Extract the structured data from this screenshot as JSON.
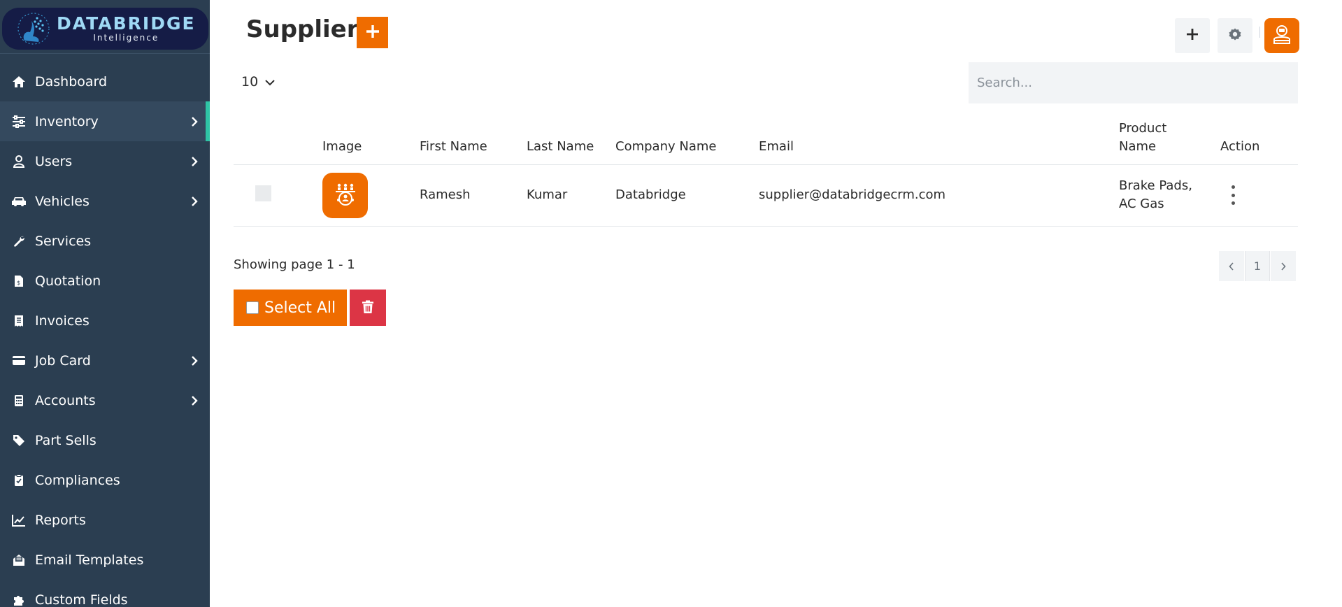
{
  "brand": {
    "name": "DATABRIDGE",
    "tagline": "Intelligence"
  },
  "sidebar": {
    "items": [
      {
        "label": "Dashboard",
        "icon": "home-icon",
        "has_submenu": false,
        "active": false
      },
      {
        "label": "Inventory",
        "icon": "sliders-icon",
        "has_submenu": true,
        "active": true
      },
      {
        "label": "Users",
        "icon": "user-icon",
        "has_submenu": true,
        "active": false
      },
      {
        "label": "Vehicles",
        "icon": "car-icon",
        "has_submenu": true,
        "active": false
      },
      {
        "label": "Services",
        "icon": "wrench-icon",
        "has_submenu": false,
        "active": false
      },
      {
        "label": "Quotation",
        "icon": "file-invoice-icon",
        "has_submenu": false,
        "active": false
      },
      {
        "label": "Invoices",
        "icon": "receipt-icon",
        "has_submenu": false,
        "active": false
      },
      {
        "label": "Job Card",
        "icon": "credit-card-icon",
        "has_submenu": true,
        "active": false
      },
      {
        "label": "Accounts",
        "icon": "calculator-icon",
        "has_submenu": true,
        "active": false
      },
      {
        "label": "Part Sells",
        "icon": "tag-icon",
        "has_submenu": false,
        "active": false
      },
      {
        "label": "Compliances",
        "icon": "clipboard-check-icon",
        "has_submenu": false,
        "active": false
      },
      {
        "label": "Reports",
        "icon": "chart-line-icon",
        "has_submenu": false,
        "active": false
      },
      {
        "label": "Email Templates",
        "icon": "envelope-open-icon",
        "has_submenu": false,
        "active": false
      },
      {
        "label": "Custom Fields",
        "icon": "puzzle-icon",
        "has_submenu": false,
        "active": false
      }
    ]
  },
  "header": {
    "title": "Suppliers",
    "add_icon": "plus-icon",
    "actions": [
      "plus-icon",
      "gear-icon",
      "user-avatar-icon"
    ]
  },
  "controls": {
    "page_size": "10",
    "search_placeholder": "Search..."
  },
  "table": {
    "columns": [
      "Image",
      "First Name",
      "Last Name",
      "Company Name",
      "Email",
      "Product Name",
      "Action"
    ],
    "product_name_header_line1": "Product",
    "product_name_header_line2": "Name",
    "rows": [
      {
        "image_icon": "supplier-network-icon",
        "first_name": "Ramesh",
        "last_name": "Kumar",
        "company_name": "Databridge",
        "email": "supplier@databridgecrm.com",
        "product_name_line1": "Brake Pads,",
        "product_name_line2": "AC Gas"
      }
    ]
  },
  "footer": {
    "showing": "Showing page 1 - 1",
    "current_page": "1",
    "select_all": "Select All"
  },
  "colors": {
    "sidebar_bg": "#2b3e51",
    "accent": "#ef6c00",
    "active_indicator": "#2ec4a5",
    "danger": "#dc3545"
  }
}
